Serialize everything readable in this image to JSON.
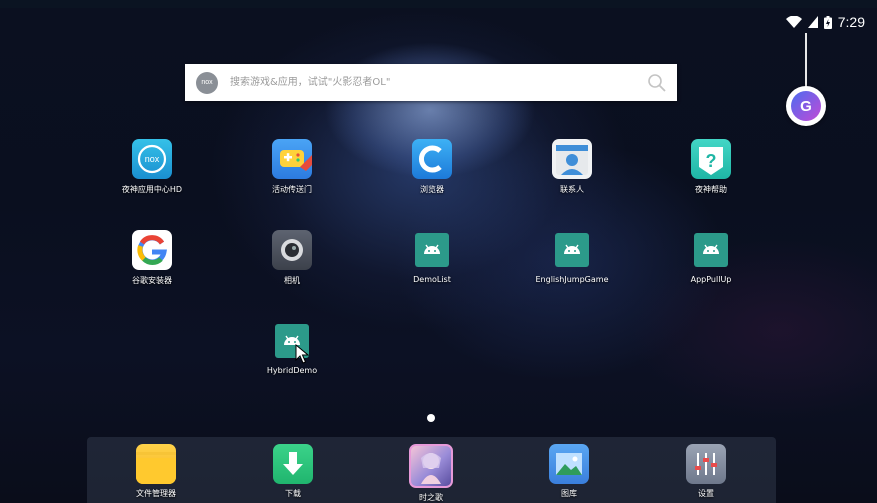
{
  "status_bar": {
    "time": "7:29"
  },
  "search": {
    "placeholder": "搜索游戏&应用，试试\"火影忍者OL\"",
    "badge_text": "nox"
  },
  "floating_button": {
    "letter": "G"
  },
  "apps": [
    {
      "label": "夜神应用中心HD",
      "icon": "nox-appcenter-icon"
    },
    {
      "label": "活动传送门",
      "icon": "gamepad-icon"
    },
    {
      "label": "浏览器",
      "icon": "browser-icon"
    },
    {
      "label": "联系人",
      "icon": "contacts-icon"
    },
    {
      "label": "夜神帮助",
      "icon": "help-icon"
    },
    {
      "label": "谷歌安装器",
      "icon": "google-installer-icon"
    },
    {
      "label": "相机",
      "icon": "camera-icon"
    },
    {
      "label": "DemoList",
      "icon": "android-icon"
    },
    {
      "label": "EnglishJumpGame",
      "icon": "android-icon"
    },
    {
      "label": "AppPullUp",
      "icon": "android-icon"
    },
    {
      "label": "HybridDemo",
      "icon": "android-icon"
    }
  ],
  "dock": [
    {
      "label": "文件管理器",
      "icon": "folder-icon"
    },
    {
      "label": "下载",
      "icon": "download-icon"
    },
    {
      "label": "时之歌",
      "icon": "game-icon"
    },
    {
      "label": "图库",
      "icon": "gallery-icon"
    },
    {
      "label": "设置",
      "icon": "settings-icon"
    }
  ],
  "colors": {
    "android_tile": "#2c9a8a",
    "search_bg": "#ffffff"
  }
}
